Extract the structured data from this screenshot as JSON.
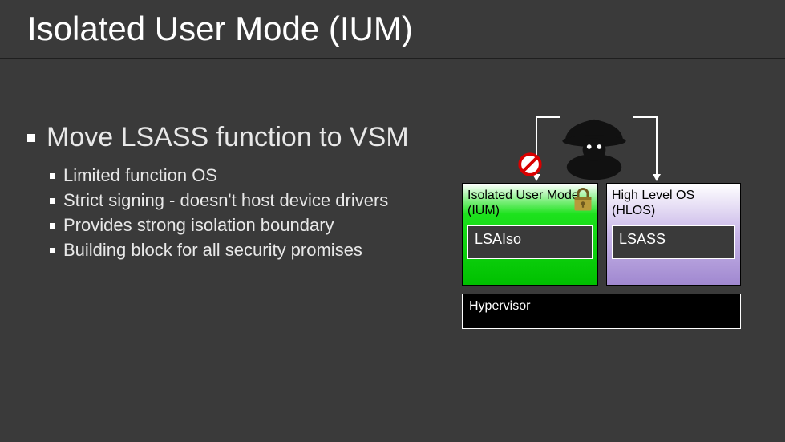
{
  "title": "Isolated User Mode (IUM)",
  "main_bullet": "Move LSASS function to VSM",
  "sub_bullets": [
    "Limited function OS",
    "Strict signing - doesn't host device drivers",
    "Provides strong isolation boundary",
    "Building block for all security promises"
  ],
  "diagram": {
    "ium": {
      "label": "Isolated User Mode (IUM)",
      "inner": "LSAIso"
    },
    "hlos": {
      "label": "High Level OS (HLOS)",
      "inner": "LSASS"
    },
    "hypervisor": "Hypervisor"
  },
  "icons": {
    "hacker": "hacker-icon",
    "no": "no-entry-icon",
    "lock": "lock-icon"
  }
}
